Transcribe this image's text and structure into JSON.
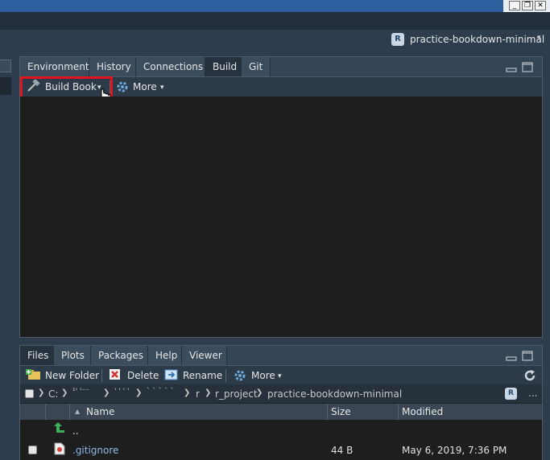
{
  "window": {
    "min": "_",
    "max": "❐",
    "close": "✕"
  },
  "project": {
    "icon": "R",
    "name": "practice-bookdown-minimal",
    "caret": "▾"
  },
  "build_pane": {
    "tabs": [
      "Environment",
      "History",
      "Connections",
      "Build",
      "Git"
    ],
    "active_tab": "Build",
    "toolbar": {
      "build_book": "Build Book",
      "build_caret": "▾",
      "more": "More",
      "more_caret": "▾"
    }
  },
  "files_pane": {
    "tabs": [
      "Files",
      "Plots",
      "Packages",
      "Help",
      "Viewer"
    ],
    "active_tab": "Files",
    "toolbar": {
      "new_folder": "New Folder",
      "delete": "Delete",
      "rename": "Rename",
      "more": "More",
      "more_caret": "▾"
    },
    "path": [
      "C:",
      "¹' '⁻⁻",
      "' ' ' '",
      "` ` ` ` `",
      "r",
      "r_project",
      "practice-bookdown-minimal"
    ],
    "columns": {
      "name": "Name",
      "size": "Size",
      "modified": "Modified"
    },
    "rows": [
      {
        "name": "..",
        "size": "",
        "modified": ""
      },
      {
        "name": ".gitignore",
        "size": "44 B",
        "modified": "May 6, 2019, 7:36 PM"
      }
    ],
    "ellipsis": "..."
  }
}
